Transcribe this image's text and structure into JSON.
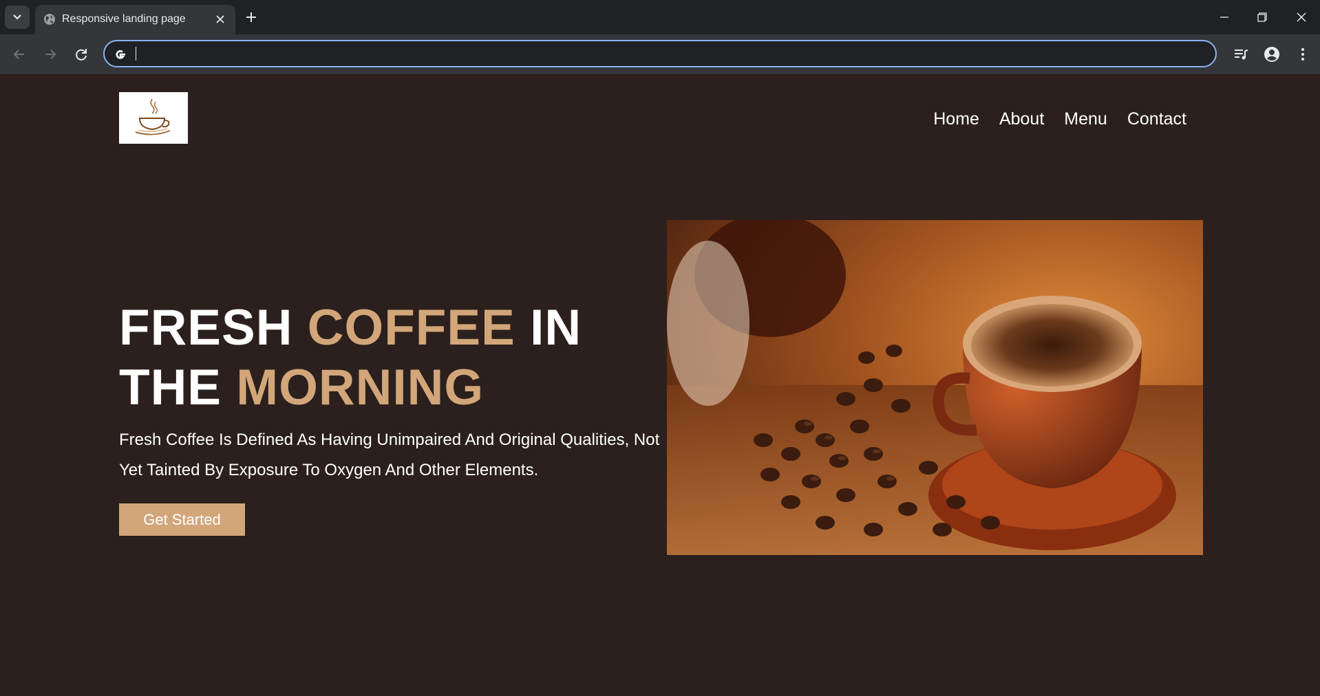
{
  "browser": {
    "tab_title": "Responsive landing page",
    "omnibox_value": "",
    "accent_color": "#8ab4f8"
  },
  "site": {
    "logo": "coffee-cup-logo",
    "nav": [
      "Home",
      "About",
      "Menu",
      "Contact"
    ],
    "hero": {
      "title_parts": [
        {
          "text": "FRESH ",
          "accent": false
        },
        {
          "text": "COFFEE",
          "accent": true
        },
        {
          "text": " IN THE ",
          "accent": false
        },
        {
          "text": "MORNING",
          "accent": true
        }
      ],
      "description": "Fresh Coffee Is Defined As Having Unimpaired And Original Qualities, Not Yet Tainted By Exposure To Oxygen And Other Elements.",
      "cta_label": "Get Started",
      "image": "coffee-cup-and-beans-photo"
    },
    "colors": {
      "background": "#2b201d",
      "accent": "#d2a679",
      "text": "#ffffff"
    }
  }
}
